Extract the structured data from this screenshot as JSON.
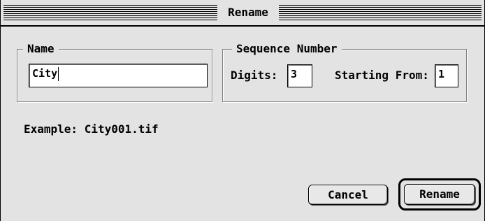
{
  "window": {
    "title": "Rename"
  },
  "name_group": {
    "label": "Name",
    "value": "City"
  },
  "sequence_group": {
    "label": "Sequence Number",
    "digits_label": "Digits:",
    "digits_value": "3",
    "start_label": "Starting From:",
    "start_value": "1"
  },
  "example": {
    "text": "Example:  City001.tif"
  },
  "buttons": {
    "cancel": "Cancel",
    "rename": "Rename"
  }
}
